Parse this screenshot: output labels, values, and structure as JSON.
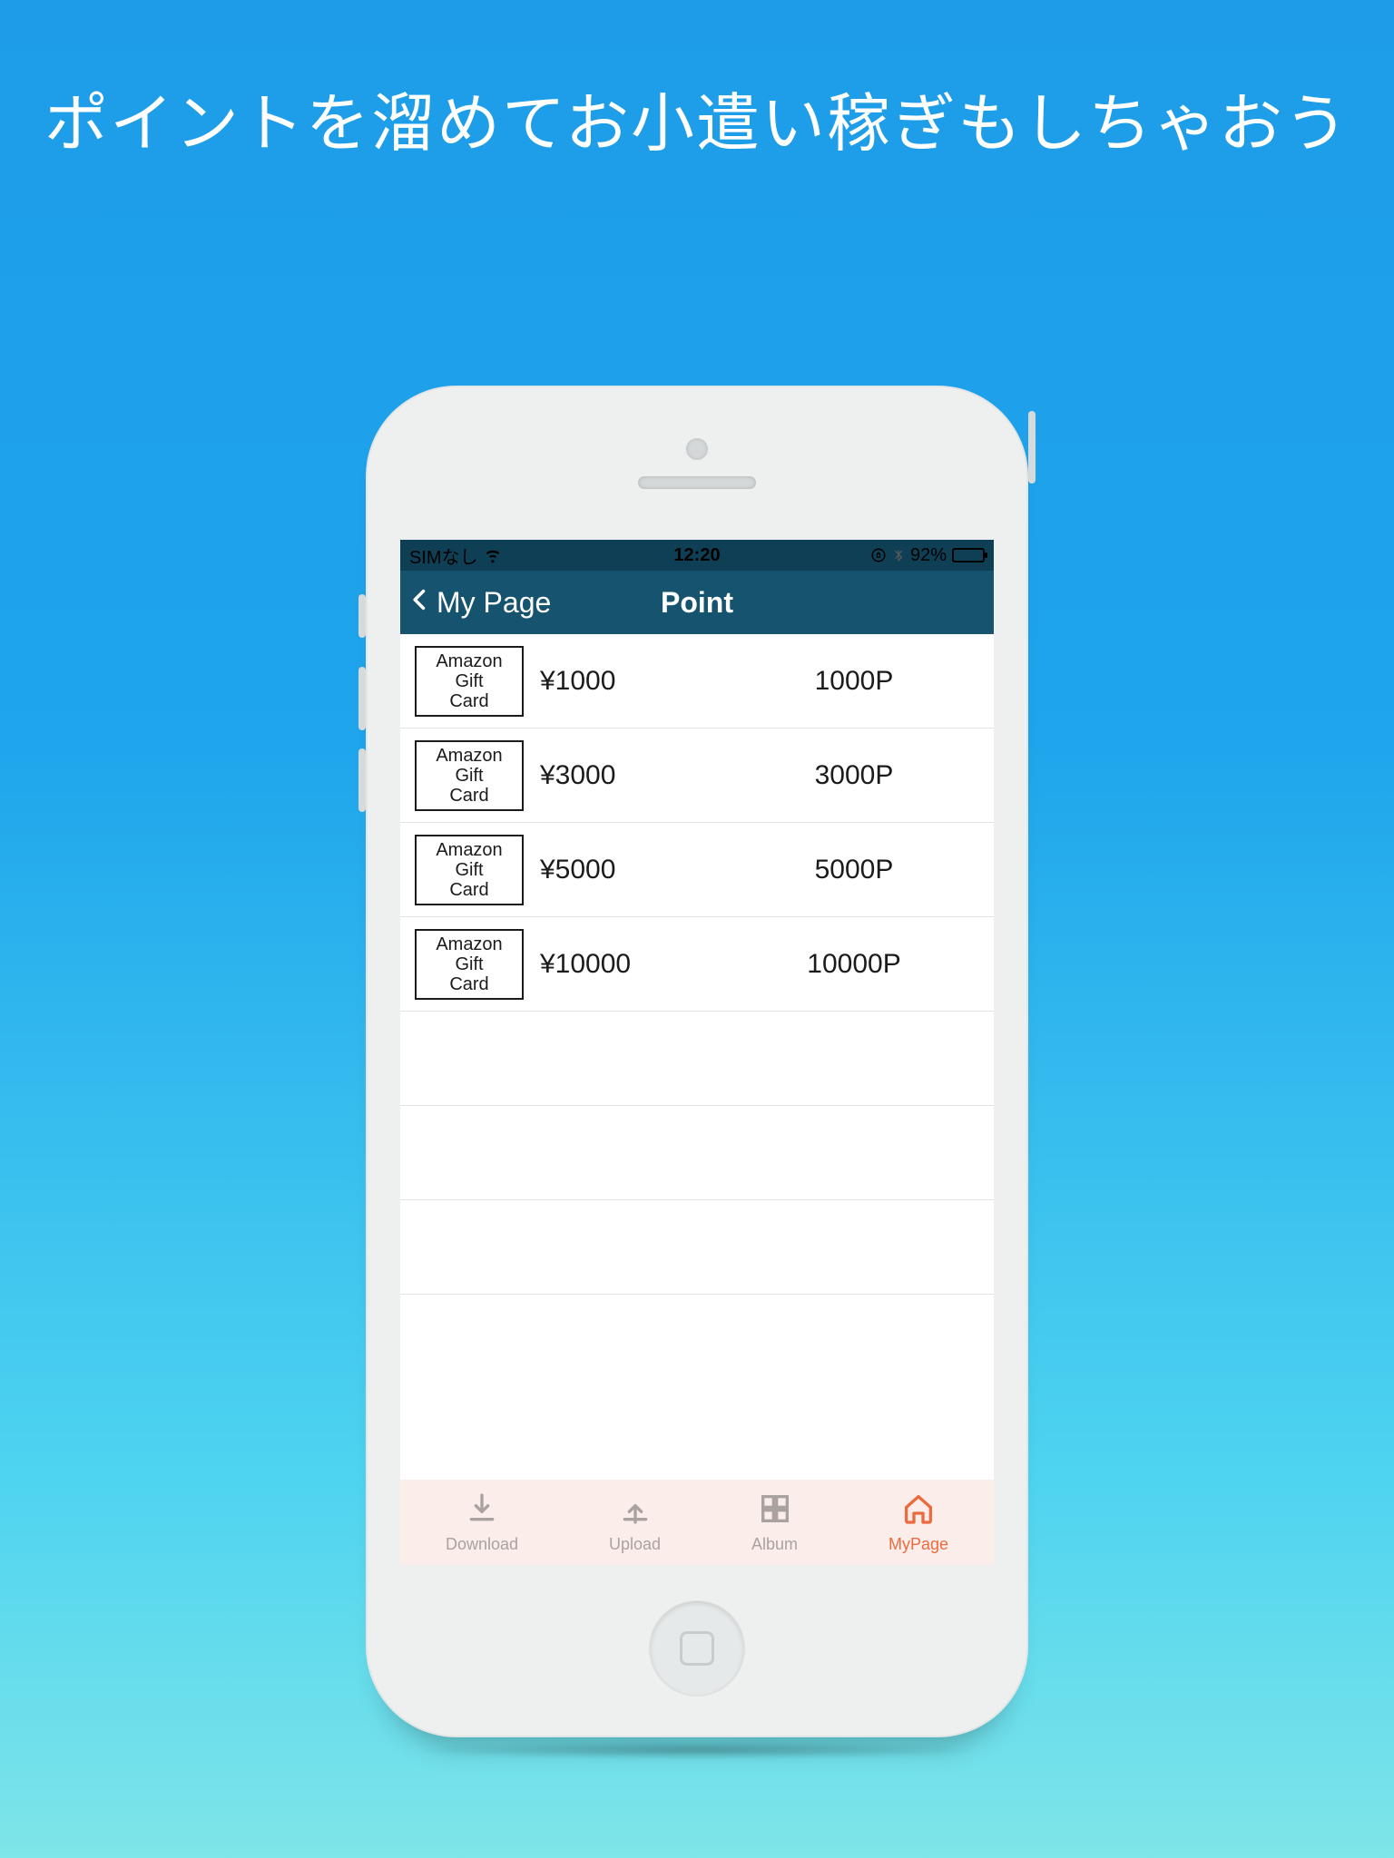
{
  "headline": "ポイントを溜めてお小遣い稼ぎもしちゃおう",
  "statusbar": {
    "carrier": "SIMなし",
    "time": "12:20",
    "battery_pct": "92%"
  },
  "navbar": {
    "back_label": "My Page",
    "title": "Point"
  },
  "card_label": "Amazon\nGift\nCard",
  "items": [
    {
      "price": "¥1000",
      "points": "1000P"
    },
    {
      "price": "¥3000",
      "points": "3000P"
    },
    {
      "price": "¥5000",
      "points": "5000P"
    },
    {
      "price": "¥10000",
      "points": "10000P"
    }
  ],
  "empty_rows": 3,
  "tabs": [
    {
      "key": "download",
      "label": "Download",
      "active": false
    },
    {
      "key": "upload",
      "label": "Upload",
      "active": false
    },
    {
      "key": "album",
      "label": "Album",
      "active": false
    },
    {
      "key": "mypage",
      "label": "MyPage",
      "active": true
    }
  ]
}
